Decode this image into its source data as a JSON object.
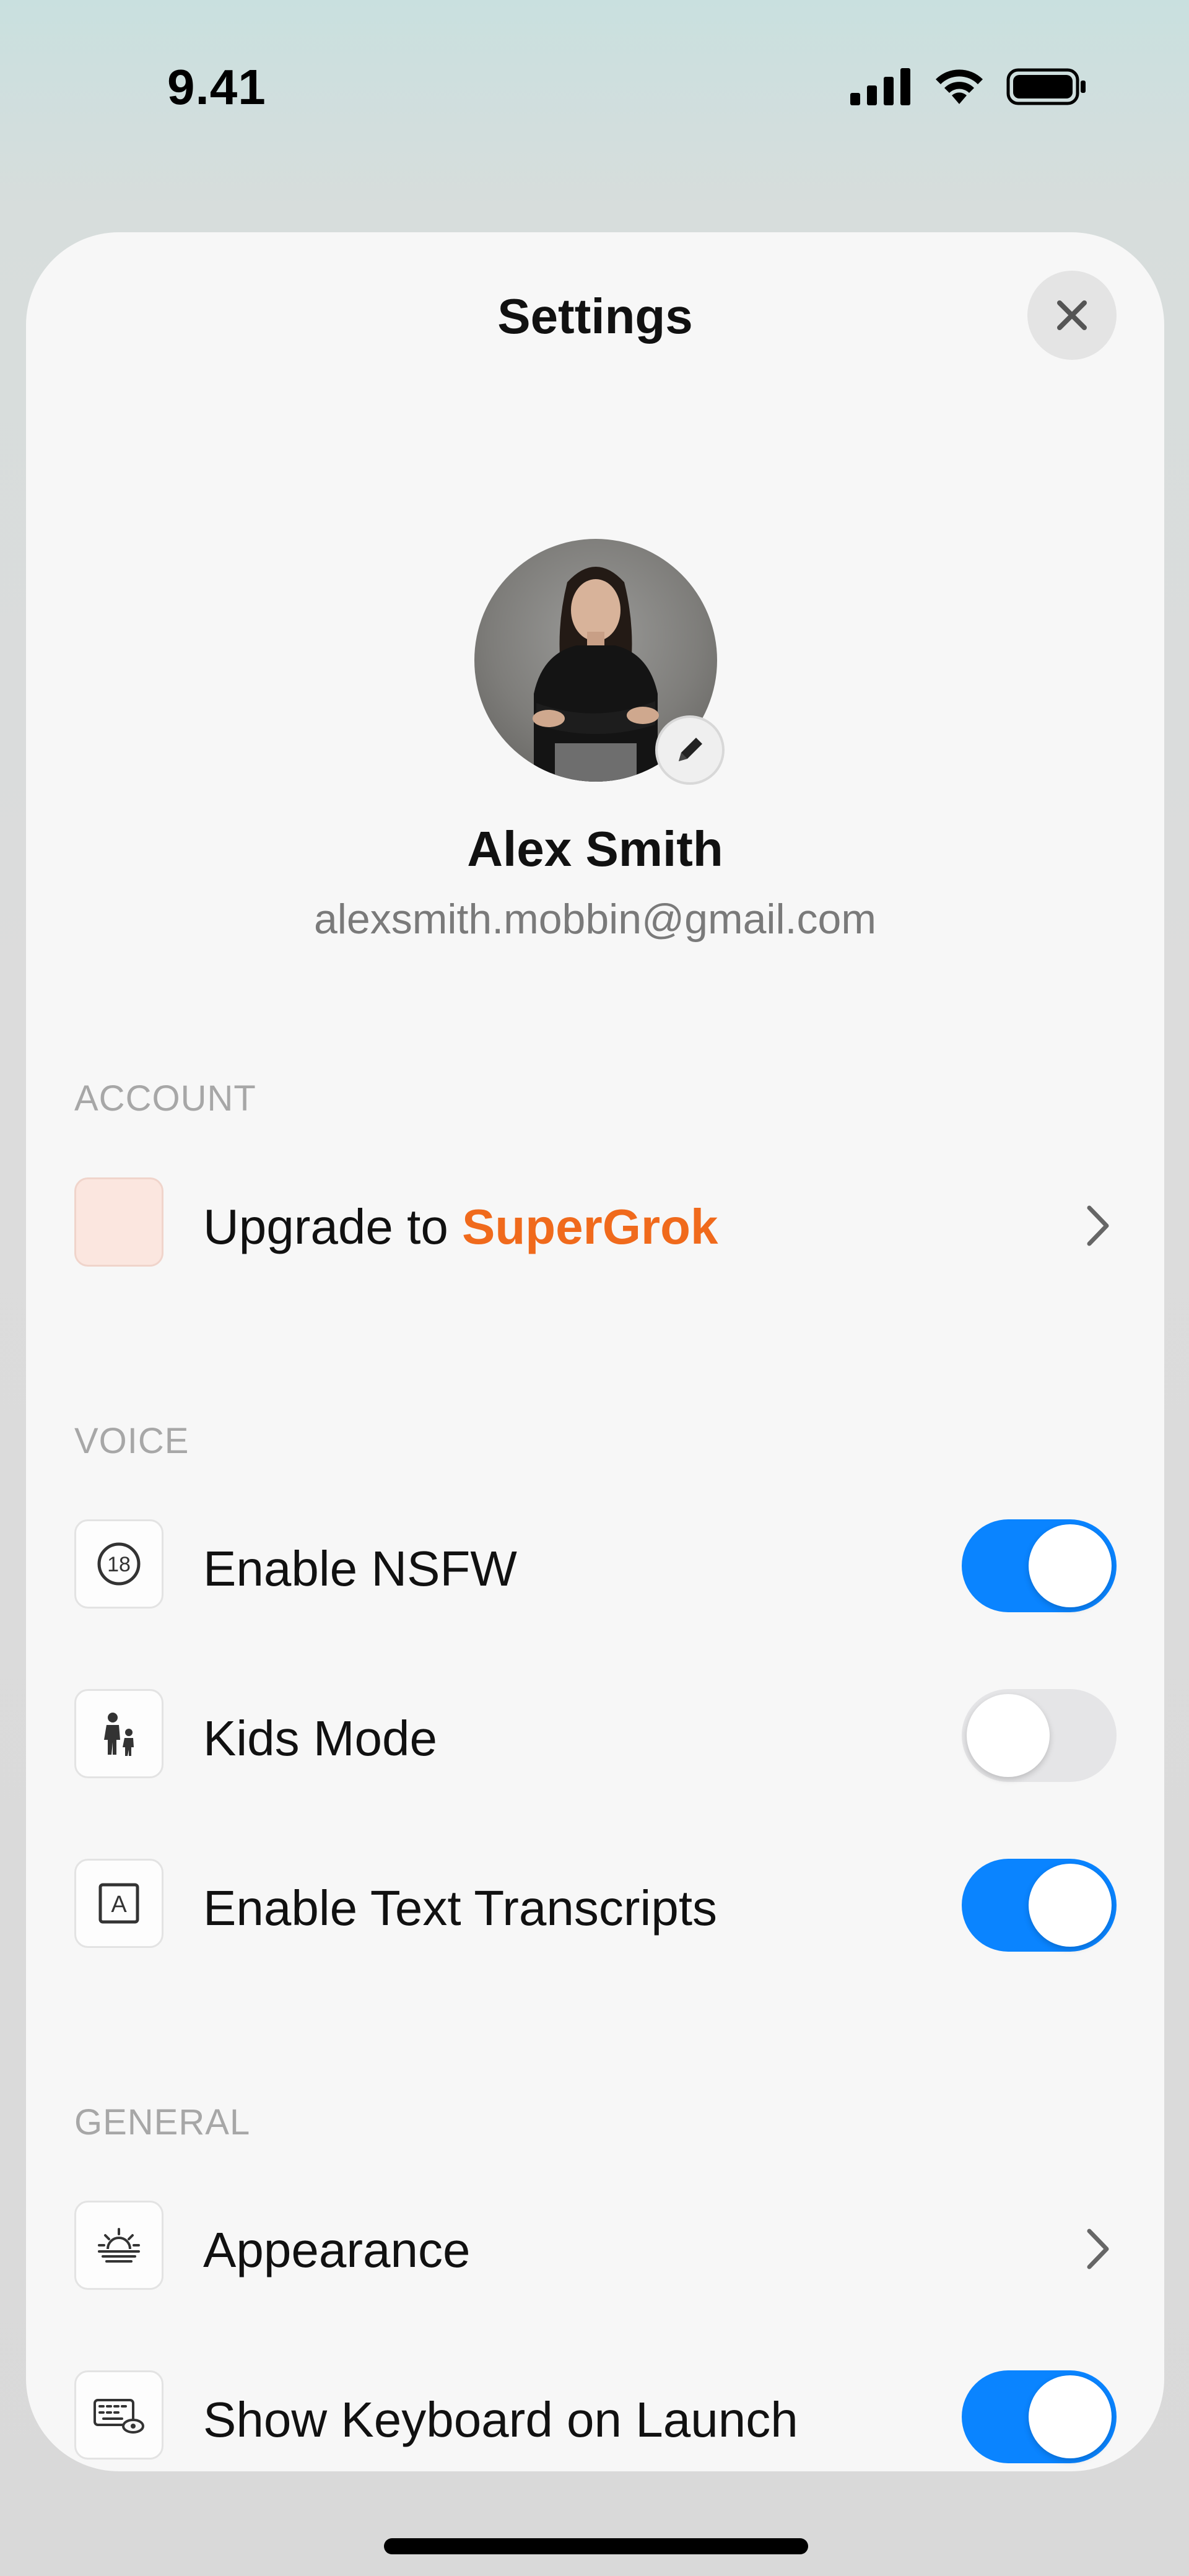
{
  "status": {
    "time": "9.41"
  },
  "header": {
    "title": "Settings"
  },
  "profile": {
    "name": "Alex Smith",
    "email": "alexsmith.mobbin@gmail.com"
  },
  "sections": {
    "account": {
      "label": "ACCOUNT",
      "upgrade": {
        "prefix": "Upgrade to ",
        "accent": "SuperGrok",
        "accent_color": "#f06a1c"
      }
    },
    "voice": {
      "label": "VOICE",
      "items": [
        {
          "label": "Enable NSFW",
          "icon": "badge-18-icon",
          "checked": true
        },
        {
          "label": "Kids Mode",
          "icon": "parent-child-icon",
          "checked": false
        },
        {
          "label": "Enable Text Transcripts",
          "icon": "text-box-icon",
          "checked": true
        }
      ]
    },
    "general": {
      "label": "GENERAL",
      "items": [
        {
          "label": "Appearance",
          "icon": "sunrise-icon"
        },
        {
          "label": "Show Keyboard on Launch",
          "icon": "keyboard-eye-icon",
          "checked": true
        }
      ]
    }
  },
  "colors": {
    "toggle_on": "#0a84ff",
    "toggle_off": "#e5e5e7",
    "accent": "#f06a1c"
  }
}
